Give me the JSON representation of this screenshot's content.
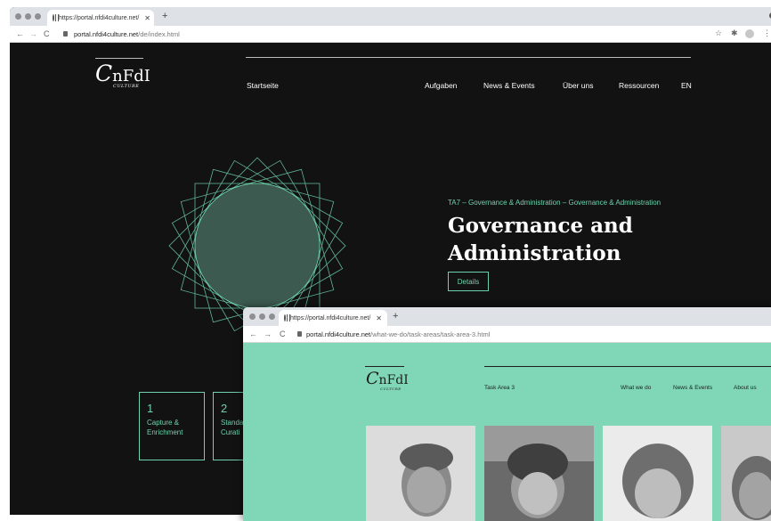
{
  "window_main": {
    "tab_title": "https://portal.nfdi4culture.net/",
    "url_host": "portal.nfdi4culture.net",
    "url_path": "/de/index.html",
    "logo": "nFdI",
    "logo_sub": "CULTURE",
    "nav": {
      "home": "Startseite",
      "items": [
        "Aufgaben",
        "News & Events",
        "Über uns",
        "Ressourcen",
        "EN"
      ]
    },
    "hero": {
      "label": "TA7 – Governance & Administration – Governance & Administration",
      "title_line1": "Governance and",
      "title_line2": "Administration",
      "button": "Details"
    },
    "cards": [
      {
        "num": "1",
        "line1": "Capture &",
        "line2": "Enrichment"
      },
      {
        "num": "2",
        "line1": "Standa",
        "line2": "Curati"
      }
    ]
  },
  "window_second": {
    "tab_title": "https://portal.nfdi4culture.net/",
    "url_host": "portal.nfdi4culture.net",
    "url_path": "/what-we-do/task-areas/task-area-3.html",
    "logo": "nFdI",
    "logo_sub": "CULTURE",
    "nav": {
      "home": "Task Area 3",
      "items": [
        "What we do",
        "News & Events",
        "About us"
      ]
    }
  },
  "colors": {
    "accent": "#6fd1ad",
    "dark_bg": "#121212",
    "mint_bg": "#7fd7b7"
  },
  "icons": [
    "globe-icon",
    "close-icon",
    "plus-icon",
    "back-icon",
    "forward-icon",
    "reload-icon",
    "lock-icon",
    "star-icon",
    "extension-icon",
    "profile-icon",
    "menu-icon"
  ]
}
